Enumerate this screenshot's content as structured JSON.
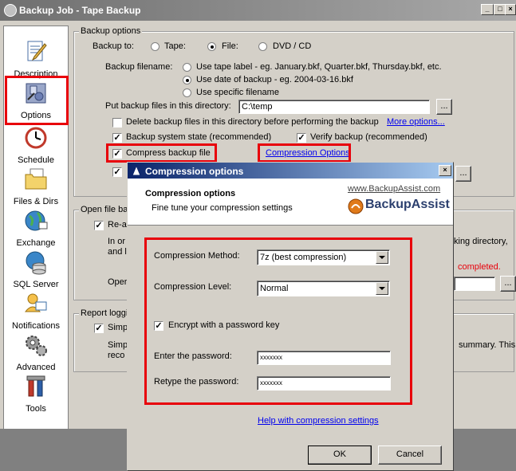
{
  "window": {
    "title": "Backup Job - Tape Backup",
    "min_glyph": "_",
    "max_glyph": "□",
    "close_glyph": "×"
  },
  "sidebar": {
    "items": [
      {
        "label": "Description",
        "icon": "description-icon"
      },
      {
        "label": "Options",
        "icon": "options-icon"
      },
      {
        "label": "Schedule",
        "icon": "clock-icon"
      },
      {
        "label": "Files & Dirs",
        "icon": "files-icon"
      },
      {
        "label": "Exchange",
        "icon": "exchange-icon"
      },
      {
        "label": "SQL Server",
        "icon": "database-icon"
      },
      {
        "label": "Notifications",
        "icon": "notifications-icon"
      },
      {
        "label": "Advanced",
        "icon": "gears-icon"
      },
      {
        "label": "Tools",
        "icon": "tools-icon"
      }
    ]
  },
  "backup_options": {
    "group_label": "Backup options",
    "backup_to_label": "Backup to:",
    "dest_tape": "Tape:",
    "dest_file": "File:",
    "dest_dvd": "DVD / CD",
    "filename_label": "Backup filename:",
    "filename_opt1": "Use tape label - eg. January.bkf, Quarter.bkf, Thursday.bkf, etc.",
    "filename_opt2": "Use date of backup - eg. 2004-03-16.bkf",
    "filename_opt3": "Use specific filename",
    "dir_label": "Put backup files in this directory:",
    "dir_value": "C:\\temp",
    "browse": "...",
    "delete_label": "Delete backup files in this directory before performing the backup",
    "more_options": "More options...",
    "system_state": "Backup system state (recommended)",
    "verify": "Verify backup (recommended)",
    "compress": "Compress backup file",
    "compression_options_link": "Compression Options",
    "check_mark": "✓"
  },
  "open_files": {
    "group_label": "Open file ba",
    "reattach": "Re-a",
    "line_in": "In or",
    "line_and": "and l",
    "line_oper": "Oper",
    "right_text": "king directory,",
    "completed": "completed."
  },
  "report": {
    "group_label": "Report loggi",
    "simp": "Simp",
    "simp2": "Simp",
    "reco": "reco",
    "right_text": "summary. This is"
  },
  "dialog": {
    "title": "Compression options",
    "close_glyph": "×",
    "header_title": "Compression options",
    "header_sub": "Fine tune your compression settings",
    "website": "www.BackupAssist.com",
    "brand": "BackupAssist",
    "method_label": "Compression Method:",
    "method_value": "7z (best compression)",
    "level_label": "Compression Level:",
    "level_value": "Normal",
    "encrypt_label": "Encrypt with a password key",
    "password_label": "Enter the password:",
    "password_value": "xxxxxxx",
    "retype_label": "Retype the password:",
    "retype_value": "xxxxxxx",
    "help_link": "Help with compression settings",
    "ok": "OK",
    "cancel": "Cancel"
  },
  "colors": {
    "highlight": "#e8000b",
    "link": "#0000ee",
    "dialog_title_start": "#0a246a",
    "dialog_title_end": "#a6caf0"
  }
}
